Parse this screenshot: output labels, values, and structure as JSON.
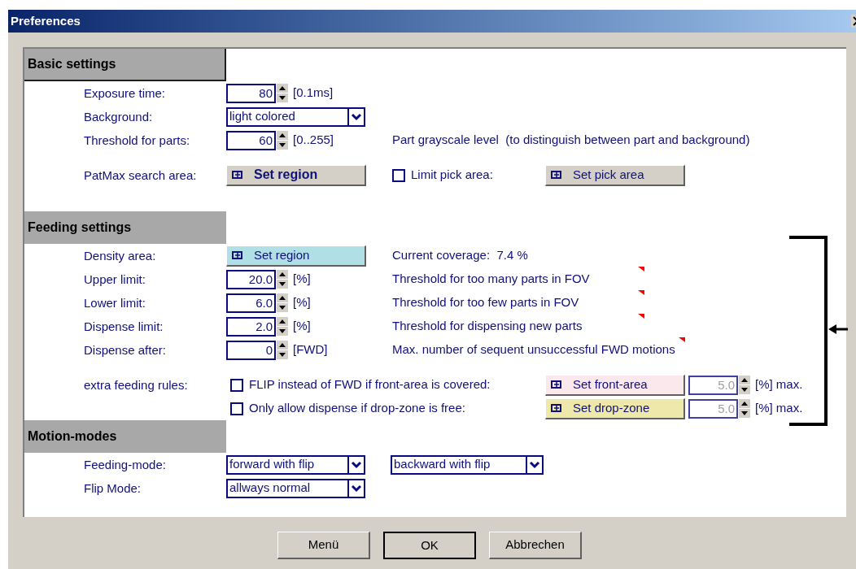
{
  "window": {
    "title": "Preferences"
  },
  "sections": [
    {
      "title": "Basic settings",
      "boxed": true,
      "rows": [
        {
          "kind": "spin",
          "label": "Exposure time:",
          "value": "80",
          "unit": "[0.1ms]",
          "disabled": false
        },
        {
          "kind": "dropdown",
          "label": "Background:",
          "selects": [
            {
              "value": "light colored"
            }
          ]
        },
        {
          "kind": "spin",
          "label": "Threshold for parts:",
          "value": "60",
          "unit": "[0..255]",
          "disabled": false,
          "note": "Part grayscale level  (to distinguish between part and background)",
          "flag": false
        },
        {
          "kind": "region",
          "label": "PatMax search area:",
          "button": {
            "text": "Set region",
            "color": "#d4d0c8",
            "bold": true
          },
          "checkbox": {
            "label": "Limit pick area:",
            "checked": false
          },
          "button2": {
            "text": "Set pick area",
            "color": "#d4d0c8",
            "bold": false
          }
        }
      ]
    },
    {
      "title": "Feeding settings",
      "boxed": false,
      "rows": [
        {
          "kind": "region",
          "label": "Density area:",
          "button": {
            "text": "Set region",
            "color": "#b0dfe6",
            "bold": false
          },
          "note": "Current coverage:  7.4 %"
        },
        {
          "kind": "spin",
          "label": "Upper limit:",
          "value": "20.0",
          "unit": "[%]",
          "disabled": false,
          "note": "Threshold for too many parts in FOV",
          "flag": true
        },
        {
          "kind": "spin",
          "label": "Lower limit:",
          "value": "6.0",
          "unit": "[%]",
          "disabled": false,
          "note": "Threshold for too few parts in FOV",
          "flag": true
        },
        {
          "kind": "spin",
          "label": "Dispense limit:",
          "value": "2.0",
          "unit": "[%]",
          "disabled": false,
          "note": "Threshold for dispensing new parts",
          "flag": true
        },
        {
          "kind": "spin",
          "label": "Dispense after:",
          "value": "0",
          "unit": "[FWD]",
          "disabled": false,
          "note": "Max. number of sequent unsuccessful FWD motions",
          "flag": true
        },
        {
          "kind": "rule",
          "label": "extra feeding rules:",
          "checkbox": {
            "label": "FLIP instead of FWD if front-area is covered:",
            "checked": false
          },
          "button": {
            "text": "Set front-area",
            "color": "#fbe8ec",
            "bold": false
          },
          "value": "5.0",
          "disabled": true,
          "unit": "[%] max."
        },
        {
          "kind": "rule",
          "checkbox": {
            "label": "Only allow dispense if drop-zone is free:",
            "checked": false
          },
          "button": {
            "text": "Set drop-zone",
            "color": "#eee8aa",
            "bold": false
          },
          "value": "5.0",
          "disabled": true,
          "unit": "[%] max."
        }
      ]
    },
    {
      "title": "Motion-modes",
      "boxed": false,
      "rows": [
        {
          "kind": "dropdown",
          "label": "Feeding-mode:",
          "selects": [
            {
              "value": "forward with flip"
            },
            {
              "value": "backward with flip"
            }
          ]
        },
        {
          "kind": "dropdown",
          "label": "Flip Mode:",
          "selects": [
            {
              "value": "allways normal"
            }
          ]
        }
      ]
    }
  ],
  "buttons": [
    {
      "label": "Menü",
      "default": false
    },
    {
      "label": "OK",
      "default": true
    },
    {
      "label": "Abbrechen",
      "default": false
    }
  ]
}
